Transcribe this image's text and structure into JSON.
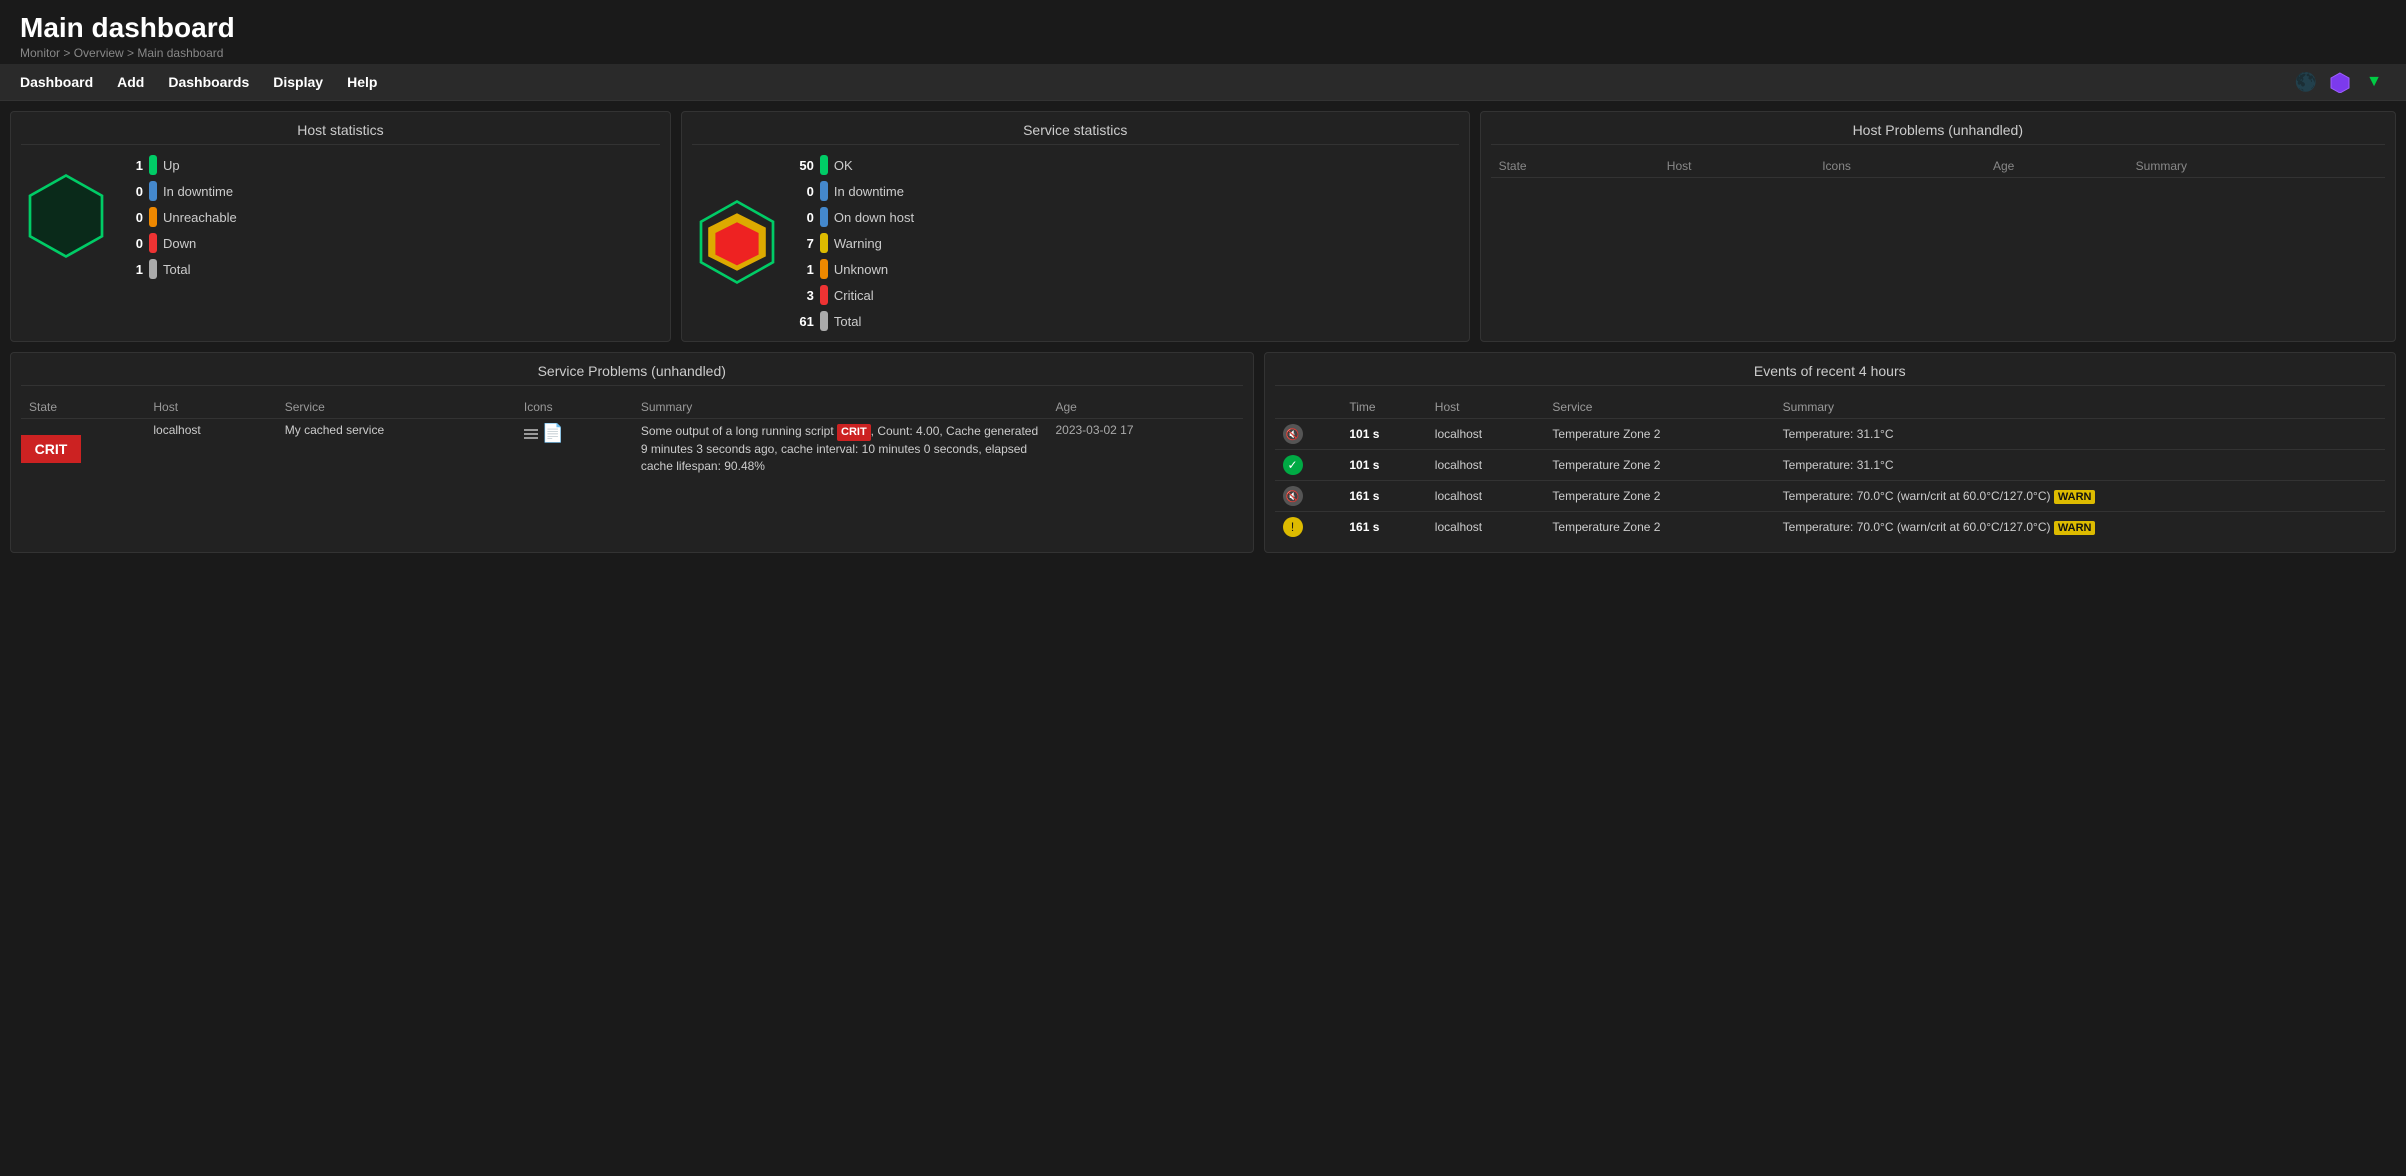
{
  "header": {
    "title": "Main dashboard",
    "breadcrumb": "Monitor > Overview > Main dashboard"
  },
  "nav": {
    "items": [
      "Dashboard",
      "Add",
      "Dashboards",
      "Display",
      "Help"
    ]
  },
  "host_stats": {
    "title": "Host statistics",
    "items": [
      {
        "count": 1,
        "label": "Up",
        "color": "green"
      },
      {
        "count": 0,
        "label": "In downtime",
        "color": "blue"
      },
      {
        "count": 0,
        "label": "Unreachable",
        "color": "orange"
      },
      {
        "count": 0,
        "label": "Down",
        "color": "red"
      },
      {
        "count": 1,
        "label": "Total",
        "color": "white"
      }
    ]
  },
  "service_stats": {
    "title": "Service statistics",
    "items": [
      {
        "count": 50,
        "label": "OK",
        "color": "green"
      },
      {
        "count": 0,
        "label": "In downtime",
        "color": "blue"
      },
      {
        "count": 0,
        "label": "On down host",
        "color": "blue"
      },
      {
        "count": 7,
        "label": "Warning",
        "color": "yellow"
      },
      {
        "count": 1,
        "label": "Unknown",
        "color": "orange"
      },
      {
        "count": 3,
        "label": "Critical",
        "color": "red"
      },
      {
        "count": 61,
        "label": "Total",
        "color": "white"
      }
    ]
  },
  "host_problems": {
    "title": "Host Problems (unhandled)",
    "columns": [
      "State",
      "Host",
      "Icons",
      "Age",
      "Summary"
    ]
  },
  "service_problems": {
    "title": "Service Problems (unhandled)",
    "columns": [
      "State",
      "Host",
      "Service",
      "Icons",
      "Summary",
      "Age"
    ],
    "rows": [
      {
        "state": "CRIT",
        "host": "localhost",
        "service": "My cached service",
        "summary_text": "Some output of a long running script",
        "crit_badge": "CRIT",
        "summary_extra": ", Count: 4.00, Cache generated 9 minutes 3 seconds ago, cache interval: 10 minutes 0 seconds, elapsed cache lifespan: 90.48%",
        "age": "2023-03-02 17"
      }
    ]
  },
  "events": {
    "title": "Events of recent 4 hours",
    "columns": [
      "Time",
      "Host",
      "Service",
      "Summary"
    ],
    "rows": [
      {
        "icon_type": "mute",
        "time": "101 s",
        "host": "localhost",
        "service": "Temperature Zone 2",
        "summary": "Temperature: 31.1°C"
      },
      {
        "icon_type": "ok",
        "time": "101 s",
        "host": "localhost",
        "service": "Temperature Zone 2",
        "summary": "Temperature: 31.1°C"
      },
      {
        "icon_type": "mute",
        "time": "161 s",
        "host": "localhost",
        "service": "Temperature Zone 2",
        "summary": "Temperature: 70.0°C (warn/crit at 60.0°C/127.0°C)",
        "warn_badge": "WARN"
      },
      {
        "icon_type": "warn",
        "time": "161 s",
        "host": "localhost",
        "service": "Temperature Zone 2",
        "summary": "Temperature: 70.0°C (warn/crit at 60.0°C/127.0°C)",
        "warn_badge": "WARN"
      }
    ]
  }
}
